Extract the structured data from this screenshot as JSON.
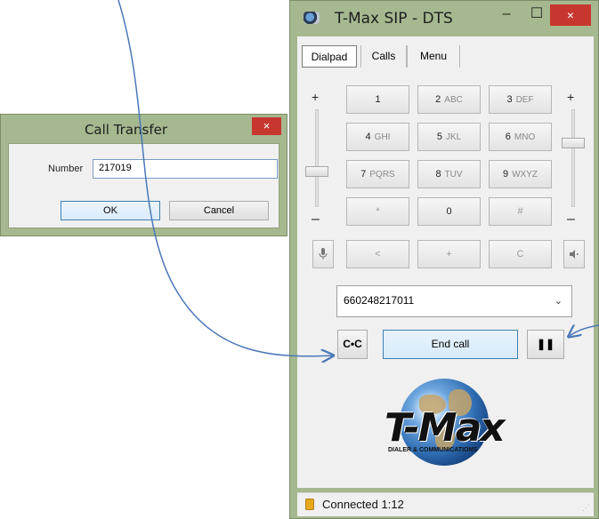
{
  "transfer_dialog": {
    "title": "Call Transfer",
    "close_icon": "×",
    "number_label": "Number",
    "number_value": "217019",
    "ok_label": "OK",
    "cancel_label": "Cancel"
  },
  "main_window": {
    "title": "T-Max SIP - DTS",
    "minimize_icon": "–",
    "maximize_icon": "☐",
    "close_icon": "×",
    "tabs": [
      {
        "label": "Dialpad",
        "active": true
      },
      {
        "label": "Calls",
        "active": false
      },
      {
        "label": "Menu",
        "active": false
      }
    ],
    "volume": {
      "plus": "+",
      "minus": "–"
    },
    "keys": [
      {
        "main": "1",
        "sub": ""
      },
      {
        "main": "2",
        "sub": "ABC"
      },
      {
        "main": "3",
        "sub": "DEF"
      },
      {
        "main": "4",
        "sub": "GHI"
      },
      {
        "main": "5",
        "sub": "JKL"
      },
      {
        "main": "6",
        "sub": "MNO"
      },
      {
        "main": "7",
        "sub": "PQRS"
      },
      {
        "main": "8",
        "sub": "TUV"
      },
      {
        "main": "9",
        "sub": "WXYZ"
      },
      {
        "main": "*",
        "sub": ""
      },
      {
        "main": "0",
        "sub": ""
      },
      {
        "main": "#",
        "sub": ""
      },
      {
        "main": "<",
        "sub": ""
      },
      {
        "main": "+",
        "sub": ""
      },
      {
        "main": "C",
        "sub": ""
      }
    ],
    "mic_icon": "microphone-icon",
    "speaker_icon": "speaker-icon",
    "number_field": "660248217011",
    "transfer_button": "C•C",
    "end_call_label": "End call",
    "hold_button": "❚❚",
    "brand": {
      "logo": "T-Max",
      "tagline": "DIALER & COMMUNICATIONS"
    },
    "status": "Connected 1:12"
  }
}
